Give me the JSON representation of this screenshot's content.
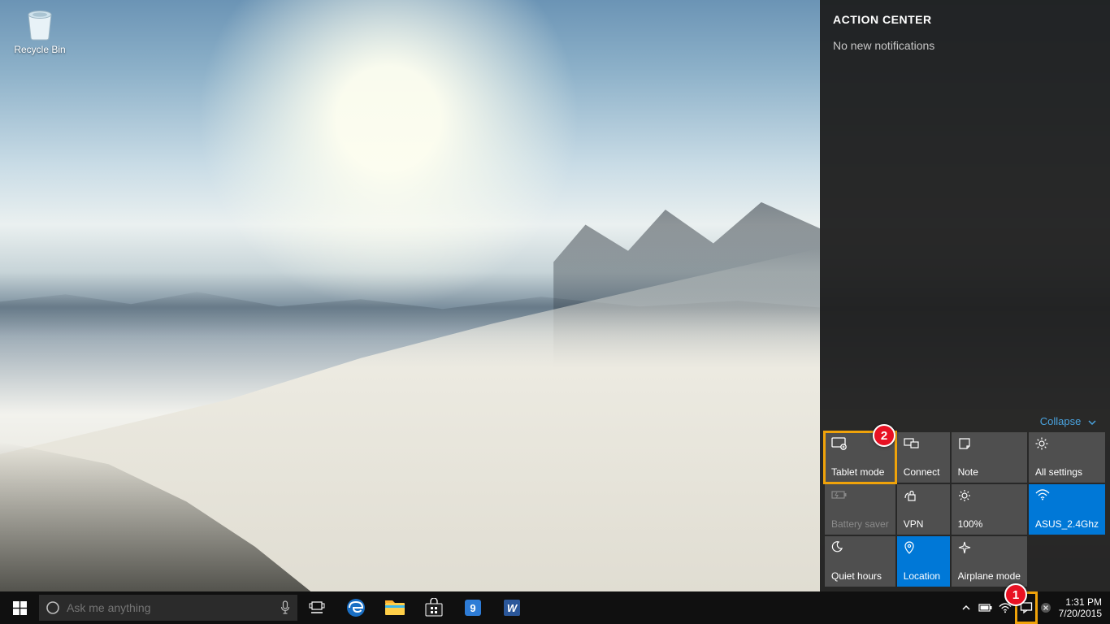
{
  "desktop": {
    "icons": [
      {
        "label": "Recycle Bin"
      }
    ]
  },
  "taskbar": {
    "search_placeholder": "Ask me anything",
    "clock_time": "1:31 PM",
    "clock_date": "7/20/2015"
  },
  "action_center": {
    "title": "ACTION CENTER",
    "status": "No new notifications",
    "collapse_label": "Collapse",
    "tiles": [
      {
        "label": "Tablet mode",
        "state": "default",
        "icon": "tablet",
        "selected": true
      },
      {
        "label": "Connect",
        "state": "default",
        "icon": "connect"
      },
      {
        "label": "Note",
        "state": "default",
        "icon": "note"
      },
      {
        "label": "All settings",
        "state": "default",
        "icon": "settings"
      },
      {
        "label": "Battery saver",
        "state": "dim",
        "icon": "battery"
      },
      {
        "label": "VPN",
        "state": "default",
        "icon": "vpn"
      },
      {
        "label": "100%",
        "state": "default",
        "icon": "brightness"
      },
      {
        "label": "ASUS_2.4Ghz",
        "state": "on",
        "icon": "wifi"
      },
      {
        "label": "Quiet hours",
        "state": "default",
        "icon": "moon"
      },
      {
        "label": "Location",
        "state": "on",
        "icon": "location"
      },
      {
        "label": "Airplane mode",
        "state": "default",
        "icon": "airplane"
      }
    ]
  },
  "annotations": {
    "badge1": "1",
    "badge2": "2"
  }
}
